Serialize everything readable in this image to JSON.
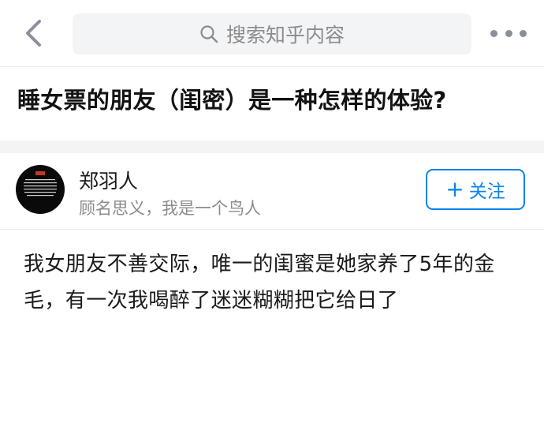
{
  "header": {
    "back_icon": "chevron-left-icon",
    "search_placeholder": "搜索知乎内容",
    "search_icon": "search-icon",
    "more_icon": "more-dots-icon"
  },
  "question": {
    "title": "睡女票的朋友（闺密）是一种怎样的体验?"
  },
  "author": {
    "name": "郑羽人",
    "bio": "顾名思义，我是一个鸟人",
    "follow_label": "关注",
    "follow_icon": "plus-icon"
  },
  "answer": {
    "text": "我女朋友不善交际，唯一的闺蜜是她家养了5年的金毛，有一次我喝醉了迷迷糊糊把它给日了"
  },
  "colors": {
    "accent": "#0a84e8",
    "muted": "#8c8c8c",
    "search_bg": "#f3f4f6"
  }
}
